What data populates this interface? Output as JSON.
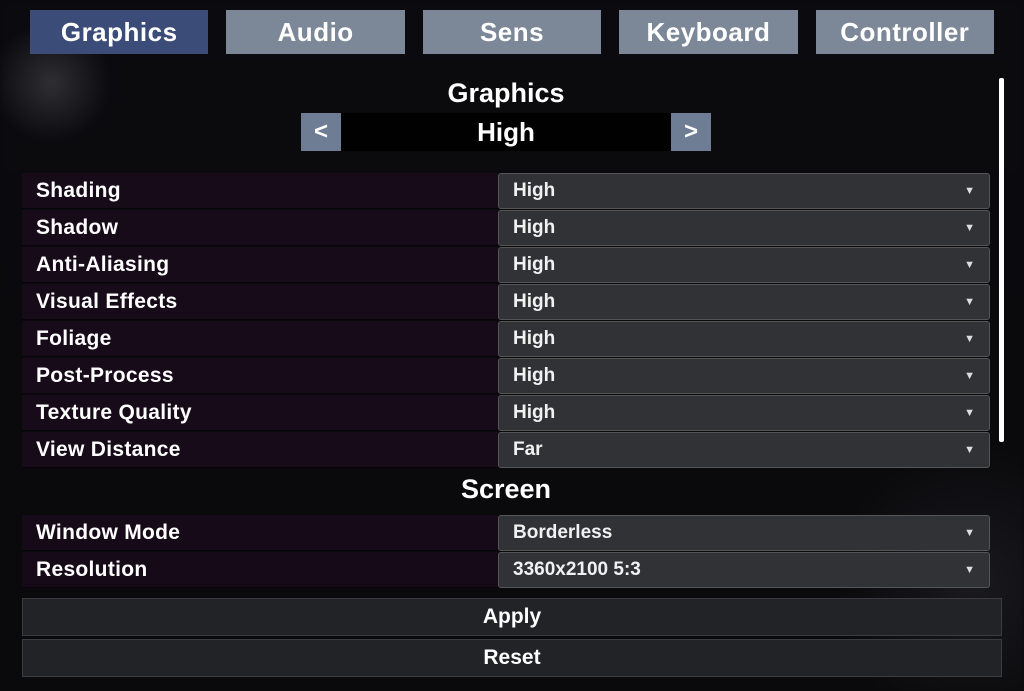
{
  "tabs": [
    {
      "label": "Graphics",
      "active": true
    },
    {
      "label": "Audio",
      "active": false
    },
    {
      "label": "Sens",
      "active": false
    },
    {
      "label": "Keyboard",
      "active": false
    },
    {
      "label": "Controller",
      "active": false
    }
  ],
  "sections": {
    "graphics": {
      "title": "Graphics",
      "preset_value": "High",
      "arrow_prev": "<",
      "arrow_next": ">",
      "rows": [
        {
          "label": "Shading",
          "value": "High"
        },
        {
          "label": "Shadow",
          "value": "High"
        },
        {
          "label": "Anti-Aliasing",
          "value": "High"
        },
        {
          "label": "Visual Effects",
          "value": "High"
        },
        {
          "label": "Foliage",
          "value": "High"
        },
        {
          "label": "Post-Process",
          "value": "High"
        },
        {
          "label": "Texture Quality",
          "value": "High"
        },
        {
          "label": "View Distance",
          "value": "Far"
        }
      ]
    },
    "screen": {
      "title": "Screen",
      "rows": [
        {
          "label": "Window Mode",
          "value": "Borderless"
        },
        {
          "label": "Resolution",
          "value": "3360x2100  5:3"
        }
      ]
    }
  },
  "footer": {
    "apply": "Apply",
    "reset": "Reset"
  }
}
